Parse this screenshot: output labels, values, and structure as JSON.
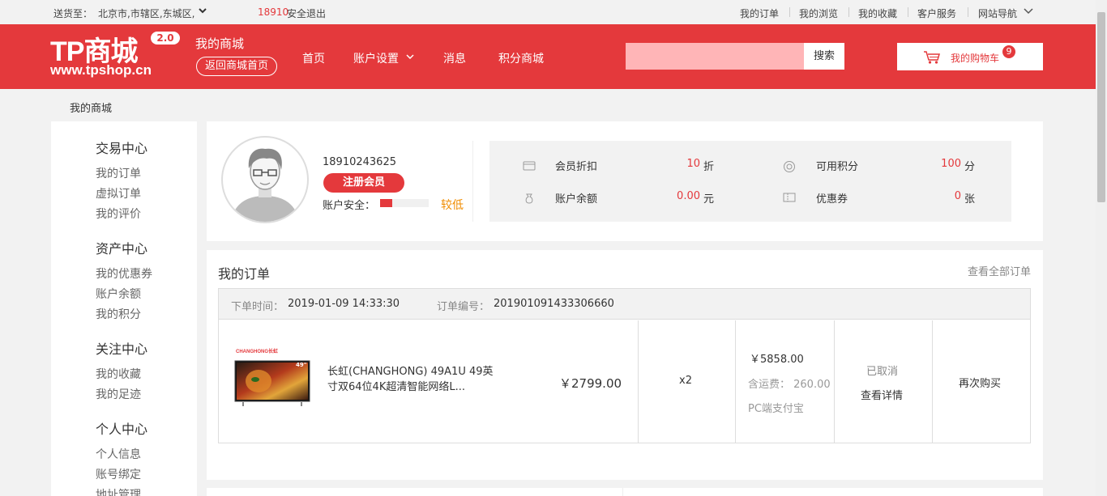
{
  "topbar": {
    "deliver_label": "送货至：",
    "deliver_location": "北京市,市辖区,东城区,",
    "user_phone": "18910",
    "logout": "安全退出",
    "links": [
      "我的订单",
      "我的浏览",
      "我的收藏",
      "客户服务",
      "网站导航"
    ]
  },
  "header": {
    "logo_text": "TP商城",
    "logo_version": "2.0",
    "logo_url": "www.tpshop.cn",
    "my_mall": "我的商城",
    "back_home": "返回商城首页",
    "nav": [
      "首页",
      "账户设置",
      "消息",
      "积分商城"
    ],
    "search_value": "",
    "search_button": "搜索",
    "cart_label": "我的购物车",
    "cart_count": "9",
    "brand_color": "#e4393c"
  },
  "breadcrumb": "我的商城",
  "sidebar": {
    "sections": [
      {
        "title": "交易中心",
        "items": [
          "我的订单",
          "虚拟订单",
          "我的评价"
        ]
      },
      {
        "title": "资产中心",
        "items": [
          "我的优惠券",
          "账户余额",
          "我的积分"
        ]
      },
      {
        "title": "关注中心",
        "items": [
          "我的收藏",
          "我的足迹"
        ]
      },
      {
        "title": "个人中心",
        "items": [
          "个人信息",
          "账号绑定",
          "地址管理"
        ]
      }
    ]
  },
  "profile": {
    "phone": "18910243625",
    "register_button": "注册会员",
    "security_label": "账户安全：",
    "security_level": "较低",
    "security_fraction": 0.25,
    "stats": [
      {
        "label": "会员折扣",
        "value": "10",
        "unit": "折",
        "icon": "card-icon"
      },
      {
        "label": "可用积分",
        "value": "100",
        "unit": "分",
        "icon": "points-icon"
      },
      {
        "label": "账户余额",
        "value": "0.00",
        "unit": "元",
        "icon": "money-bag-icon"
      },
      {
        "label": "优惠券",
        "value": "0",
        "unit": "张",
        "icon": "coupon-icon"
      }
    ]
  },
  "orders": {
    "title": "我的订单",
    "view_all": "查看全部订单",
    "order": {
      "time_label": "下单时间：",
      "time": "2019-01-09 14:33:30",
      "number_label": "订单编号：",
      "number": "201901091433306660",
      "product_brand_logo": "CHANGHONG长虹",
      "product_size_badge": "49\"",
      "product_name": "长虹(CHANGHONG) 49A1U 49英寸双64位4K超清智能网络L...",
      "unit_price": "￥2799.00",
      "quantity": "x2",
      "total": "￥5858.00",
      "shipping": "含运费： 260.00",
      "pay_method": "PC端支付宝",
      "status": "已取消",
      "detail": "查看详情",
      "rebuy": "再次购买"
    }
  }
}
